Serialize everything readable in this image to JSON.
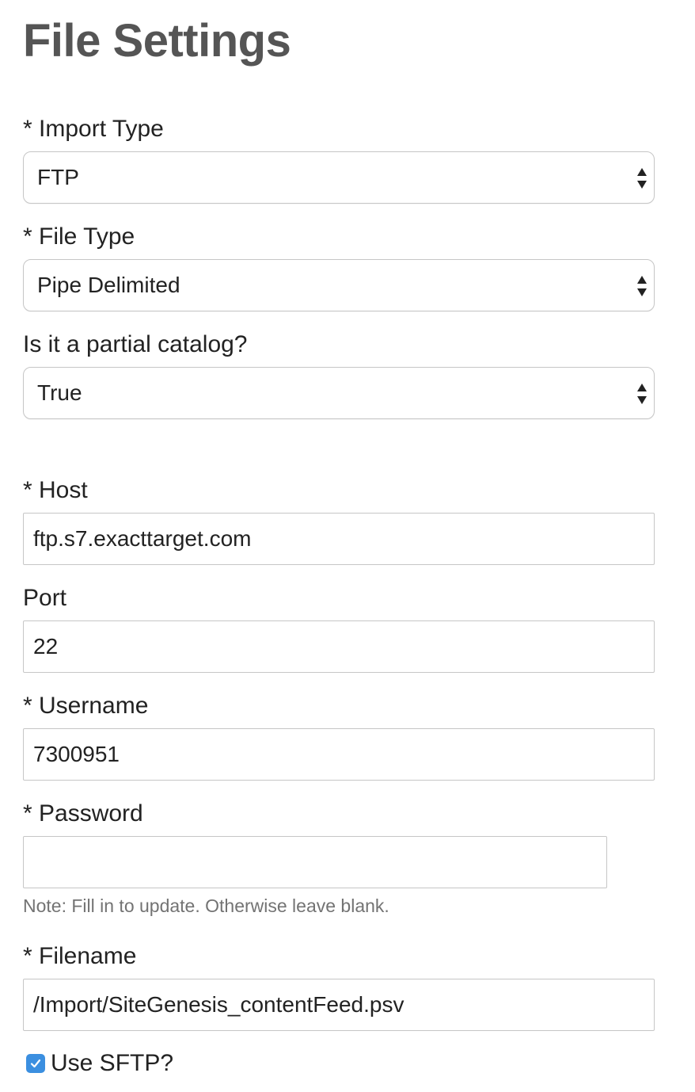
{
  "page": {
    "title": "File Settings"
  },
  "form": {
    "import_type": {
      "label": "* Import Type",
      "value": "FTP"
    },
    "file_type": {
      "label": "* File Type",
      "value": "Pipe Delimited"
    },
    "partial_catalog": {
      "label": "Is it a partial catalog?",
      "value": "True"
    },
    "host": {
      "label": "* Host",
      "value": "ftp.s7.exacttarget.com"
    },
    "port": {
      "label": "Port",
      "value": "22"
    },
    "username": {
      "label": "* Username",
      "value": "7300951"
    },
    "password": {
      "label": "* Password",
      "value": "",
      "note": "Note: Fill in to update. Otherwise leave blank."
    },
    "filename": {
      "label": "* Filename",
      "value": "/Import/SiteGenesis_contentFeed.psv"
    },
    "use_sftp": {
      "label": "Use SFTP?",
      "checked": true
    }
  },
  "colors": {
    "title": "#555555",
    "text": "#222222",
    "border": "#c6c6c6",
    "help_text": "#737373",
    "checkbox": "#3b8fe0"
  },
  "icons": {
    "select_arrows": "up-down-arrows-icon",
    "checkmark": "checkmark-icon"
  }
}
